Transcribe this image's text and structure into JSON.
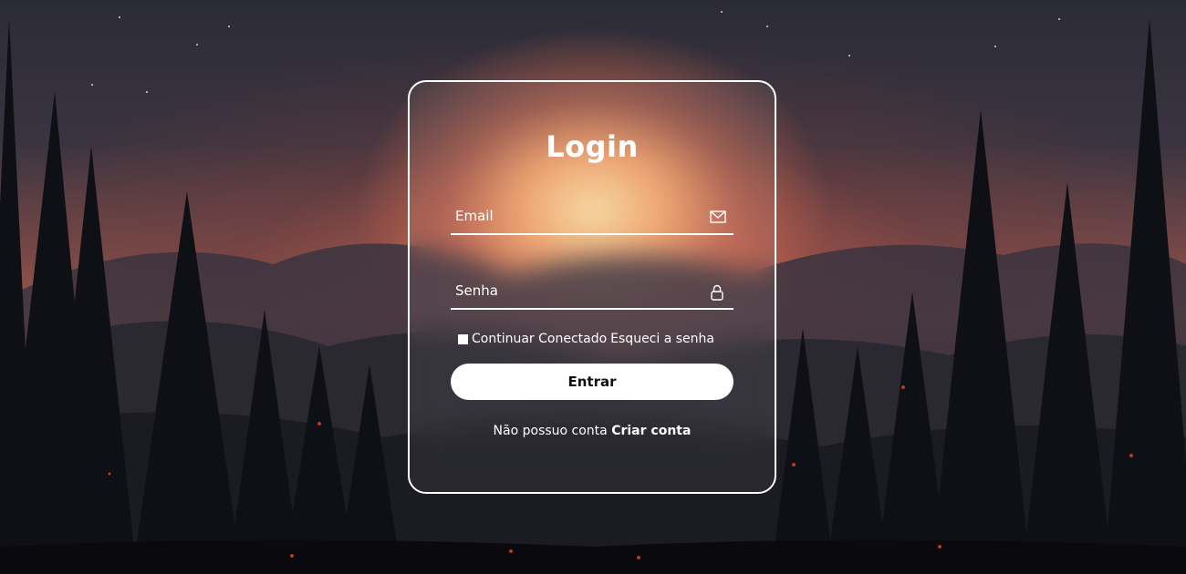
{
  "login": {
    "title": "Login",
    "email_placeholder": "Email",
    "password_placeholder": "Senha",
    "remember_label": "Continuar Conectado",
    "forgot_label": "Esqueci a senha",
    "submit_label": "Entrar",
    "no_account_text": "Não possuo conta",
    "create_account_label": "Criar conta"
  },
  "icons": {
    "email": "mail-icon",
    "password": "lock-icon"
  },
  "colors": {
    "card_border": "#ffffff",
    "button_bg": "#ffffff",
    "text": "#ffffff"
  }
}
